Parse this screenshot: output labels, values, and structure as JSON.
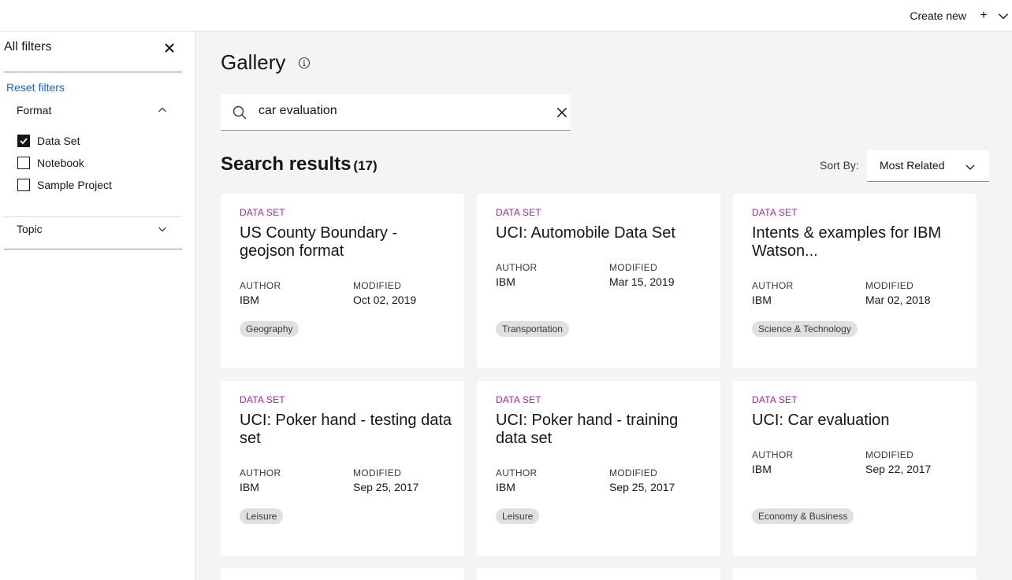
{
  "topbar": {
    "create_new": "Create new",
    "plus": "+"
  },
  "sidebar": {
    "title": "All filters",
    "reset": "Reset filters",
    "format_heading": "Format",
    "format_options": [
      {
        "label": "Data Set",
        "checked": true
      },
      {
        "label": "Notebook",
        "checked": false
      },
      {
        "label": "Sample Project",
        "checked": false
      }
    ],
    "topic_heading": "Topic"
  },
  "main": {
    "title": "Gallery",
    "search_value": "car evaluation",
    "results_label": "Search results",
    "results_count": "(17)",
    "sort_label": "Sort By:",
    "sort_value": "Most Related"
  },
  "cards": [
    {
      "kind": "DATA SET",
      "title": "US County Boundary - geojson format",
      "author_label": "AUTHOR",
      "author": "IBM",
      "modified_label": "MODIFIED",
      "modified": "Oct 02, 2019",
      "tag": "Geography"
    },
    {
      "kind": "DATA SET",
      "title": "UCI: Automobile Data Set",
      "author_label": "AUTHOR",
      "author": "IBM",
      "modified_label": "MODIFIED",
      "modified": "Mar 15, 2019",
      "tag": "Transportation"
    },
    {
      "kind": "DATA SET",
      "title": "Intents & examples for IBM Watson...",
      "author_label": "AUTHOR",
      "author": "IBM",
      "modified_label": "MODIFIED",
      "modified": "Mar 02, 2018",
      "tag": "Science & Technology"
    },
    {
      "kind": "DATA SET",
      "title": "UCI: Poker hand - testing data set",
      "author_label": "AUTHOR",
      "author": "IBM",
      "modified_label": "MODIFIED",
      "modified": "Sep 25, 2017",
      "tag": "Leisure"
    },
    {
      "kind": "DATA SET",
      "title": "UCI: Poker hand - training data set",
      "author_label": "AUTHOR",
      "author": "IBM",
      "modified_label": "MODIFIED",
      "modified": "Sep 25, 2017",
      "tag": "Leisure"
    },
    {
      "kind": "DATA SET",
      "title": "UCI: Car evaluation",
      "author_label": "AUTHOR",
      "author": "IBM",
      "modified_label": "MODIFIED",
      "modified": "Sep 22, 2017",
      "tag": "Economy & Business"
    }
  ],
  "colors": {
    "accent_link": "#0f62fe",
    "kind_label": "#b0219f",
    "tag_bg": "#e0e0e0"
  }
}
